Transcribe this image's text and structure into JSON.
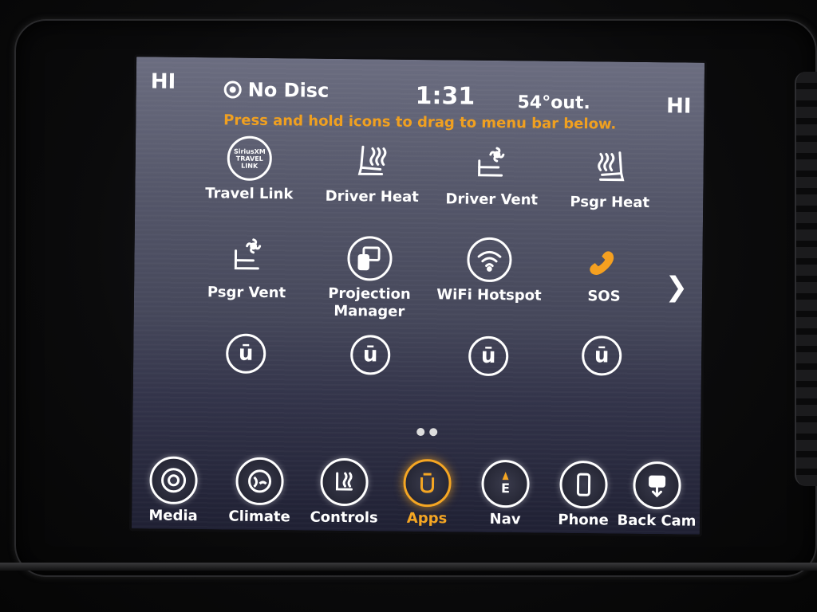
{
  "status": {
    "left_label": "HI",
    "right_label": "HI",
    "media_source": "No Disc",
    "time": "1:31",
    "temperature": "54°out."
  },
  "hint": "Press and hold icons to drag to menu bar below.",
  "travel_link_icon_text": "SiriusXM TRAVEL LINK",
  "apps_page": [
    {
      "label": "Travel Link",
      "icon": "travel-link-icon"
    },
    {
      "label": "Driver Heat",
      "icon": "heated-seat-icon"
    },
    {
      "label": "Driver Vent",
      "icon": "ventilated-seat-icon"
    },
    {
      "label": "Psgr Heat",
      "icon": "heated-seat-icon"
    },
    {
      "label": "Psgr Vent",
      "icon": "ventilated-seat-icon"
    },
    {
      "label": "Projection Manager",
      "icon": "projection-icon"
    },
    {
      "label": "WiFi Hotspot",
      "icon": "wifi-icon"
    },
    {
      "label": "SOS",
      "icon": "phone-sos-icon"
    }
  ],
  "empty_slot_glyph": "ū",
  "menu_bar": [
    {
      "label": "Media",
      "icon": "media-icon"
    },
    {
      "label": "Climate",
      "icon": "climate-icon"
    },
    {
      "label": "Controls",
      "icon": "controls-icon"
    },
    {
      "label": "Apps",
      "icon": "apps-icon",
      "active": true
    },
    {
      "label": "Nav",
      "icon": "nav-compass-icon"
    },
    {
      "label": "Phone",
      "icon": "phone-icon"
    },
    {
      "label": "Back Cam",
      "icon": "back-camera-icon"
    }
  ],
  "colors": {
    "accent": "#f5a623",
    "hint_text": "#f0a020",
    "sos": "#f5a020",
    "text": "#ffffff"
  }
}
